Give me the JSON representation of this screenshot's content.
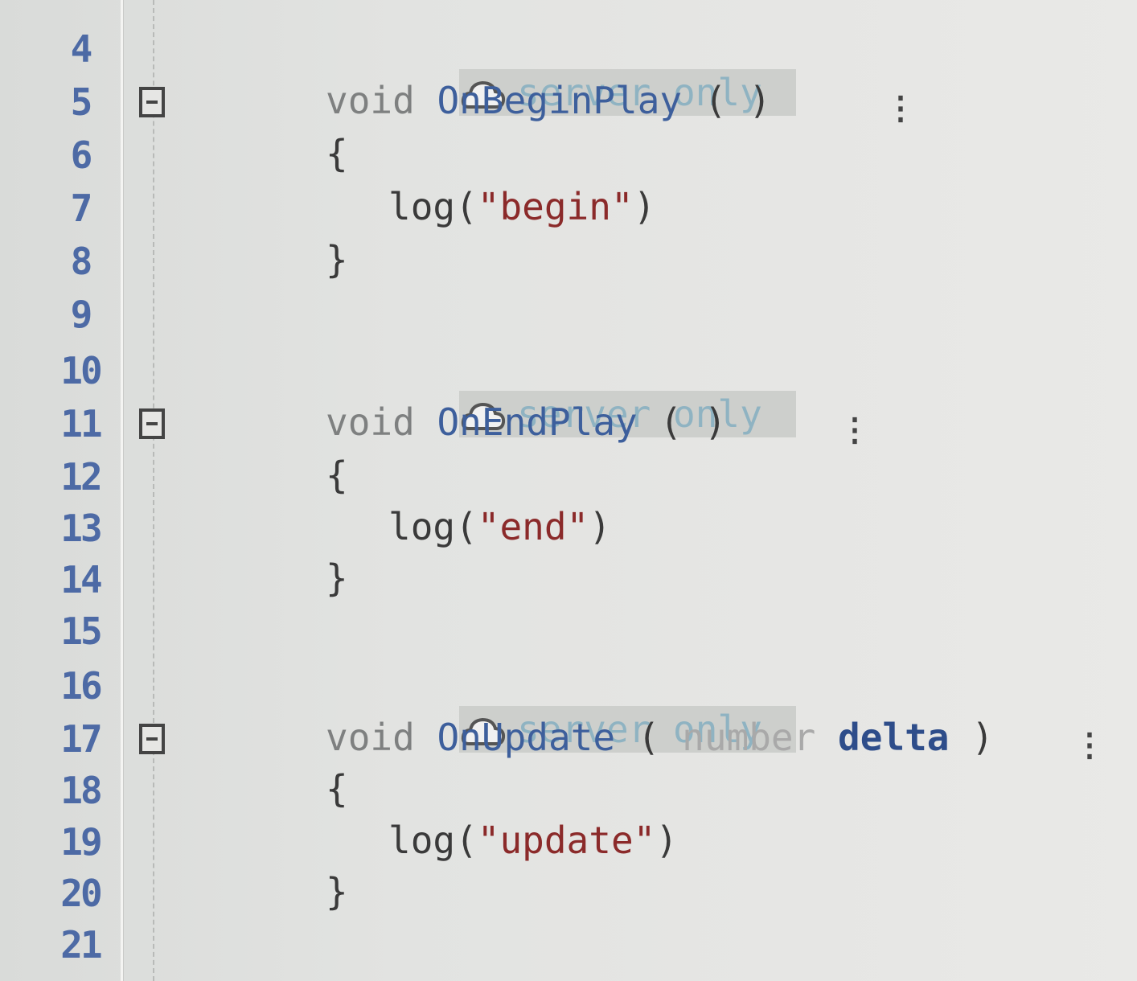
{
  "editor": {
    "annotation": "server only",
    "colors": {
      "line_numbers": "#4d6aa5",
      "keyword": "#7e8080",
      "function_name": "#3d5f9c",
      "string": "#8b2a2a",
      "annotation": "#8fb3c2",
      "parameter": "#2e4d8a"
    },
    "line_numbers": [
      "4",
      "5",
      "6",
      "7",
      "8",
      "9",
      "10",
      "11",
      "12",
      "13",
      "14",
      "15",
      "16",
      "17",
      "18",
      "19",
      "20",
      "21"
    ],
    "functions": [
      {
        "return_type": "void",
        "name": "OnBeginPlay",
        "open_paren": "( ",
        "param_type": "",
        "param_name": "",
        "close_paren": ")",
        "log_call": "log(",
        "log_string": "\"begin\"",
        "log_close": ")"
      },
      {
        "return_type": "void",
        "name": "OnEndPlay",
        "open_paren": "( ",
        "param_type": "",
        "param_name": "",
        "close_paren": ")",
        "log_call": "log(",
        "log_string": "\"end\"",
        "log_close": ")"
      },
      {
        "return_type": "void",
        "name": "OnUpdate",
        "open_paren": "( ",
        "param_type": "number",
        "param_name": "delta",
        "close_paren": " )",
        "log_call": "log(",
        "log_string": "\"update\"",
        "log_close": ")"
      }
    ],
    "open_brace": "{",
    "close_brace": "}",
    "more_menu_icon": "kebab-vertical-icon",
    "annotation_icon": "cloud-icon",
    "fold_icon": "fold-collapse-icon"
  }
}
